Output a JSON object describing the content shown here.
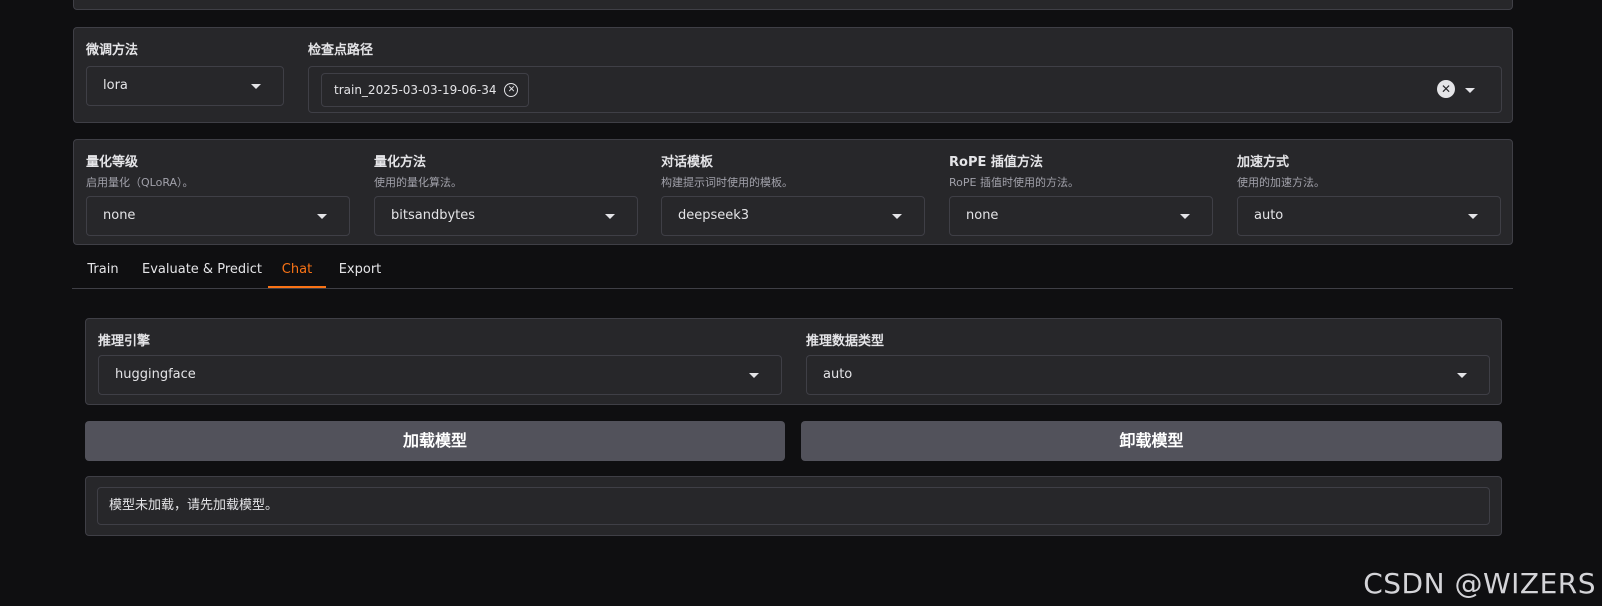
{
  "finetune": {
    "method_label": "微调方法",
    "method_value": "lora",
    "checkpoint_label": "检查点路径",
    "checkpoint_chip": "train_2025-03-03-19-06-34"
  },
  "quant": {
    "bit": {
      "label": "量化等级",
      "desc": "启用量化（QLoRA）。",
      "value": "none"
    },
    "method": {
      "label": "量化方法",
      "desc": "使用的量化算法。",
      "value": "bitsandbytes"
    },
    "template": {
      "label": "对话模板",
      "desc": "构建提示词时使用的模板。",
      "value": "deepseek3"
    },
    "rope": {
      "label": "RoPE 插值方法",
      "desc": "RoPE 插值时使用的方法。",
      "value": "none"
    },
    "booster": {
      "label": "加速方式",
      "desc": "使用的加速方法。",
      "value": "auto"
    }
  },
  "tabs": [
    {
      "label": "Train"
    },
    {
      "label": "Evaluate & Predict"
    },
    {
      "label": "Chat"
    },
    {
      "label": "Export"
    }
  ],
  "chat": {
    "infer_engine_label": "推理引擎",
    "infer_engine_value": "huggingface",
    "infer_dtype_label": "推理数据类型",
    "infer_dtype_value": "auto",
    "load_button": "加载模型",
    "unload_button": "卸载模型",
    "info_text": "模型未加载，请先加载模型。"
  },
  "watermark": "CSDN @WIZERS",
  "colors": {
    "accent": "#f97316",
    "panel": "#27272a",
    "background": "#0f0f11"
  }
}
